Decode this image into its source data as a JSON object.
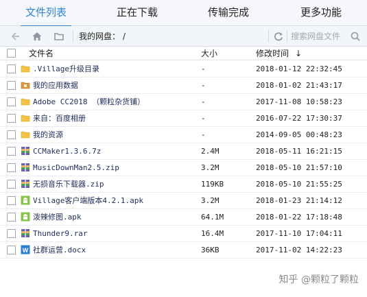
{
  "tabs": [
    {
      "label": "文件列表",
      "active": true
    },
    {
      "label": "正在下载",
      "active": false
    },
    {
      "label": "传输完成",
      "active": false
    },
    {
      "label": "更多功能",
      "active": false
    }
  ],
  "toolbar": {
    "path": "我的网盘： /",
    "search_placeholder": "搜索网盘文件"
  },
  "columns": {
    "name": "文件名",
    "size": "大小",
    "time": "修改时间",
    "sort_indicator": "↓"
  },
  "files": [
    {
      "name": ".Village升级目录",
      "size": "-",
      "time": "2018-01-12 22:32:45",
      "icon": "folder-icon"
    },
    {
      "name": "我的应用数据",
      "size": "-",
      "time": "2018-01-02 21:43:17",
      "icon": "app-folder-icon"
    },
    {
      "name": "Adobe CC2018 （颗粒杂货铺）",
      "size": "-",
      "time": "2017-11-08 10:58:23",
      "icon": "folder-icon"
    },
    {
      "name": "来自：百度相册",
      "size": "-",
      "time": "2016-07-22 17:30:37",
      "icon": "folder-icon"
    },
    {
      "name": "我的资源",
      "size": "-",
      "time": "2014-09-05 00:48:23",
      "icon": "folder-icon"
    },
    {
      "name": "CCMaker1.3.6.7z",
      "size": "2.4M",
      "time": "2018-05-11 16:21:15",
      "icon": "archive-icon"
    },
    {
      "name": "MusicDownMan2.5.zip",
      "size": "3.2M",
      "time": "2018-05-10 21:57:10",
      "icon": "archive-icon"
    },
    {
      "name": "无损音乐下载器.zip",
      "size": "119KB",
      "time": "2018-05-10 21:55:25",
      "icon": "archive-icon"
    },
    {
      "name": "Village客户端版本4.2.1.apk",
      "size": "3.2M",
      "time": "2018-01-23 21:14:12",
      "icon": "android-icon"
    },
    {
      "name": "泼辣修图.apk",
      "size": "64.1M",
      "time": "2018-01-22 17:18:48",
      "icon": "android-icon"
    },
    {
      "name": "Thunder9.rar",
      "size": "16.4M",
      "time": "2017-11-10 17:04:11",
      "icon": "archive-icon"
    },
    {
      "name": "社群运营.docx",
      "size": "36KB",
      "time": "2017-11-02 14:22:23",
      "icon": "word-doc-icon"
    }
  ],
  "watermark": "知乎 @颗粒了颗粒",
  "colors": {
    "accent": "#2f82d3",
    "folder": "#f4c542",
    "android": "#8bc34a",
    "word": "#2b7cd3"
  }
}
